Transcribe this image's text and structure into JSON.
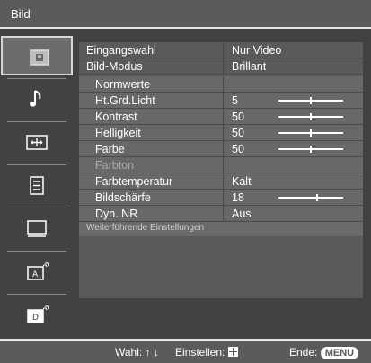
{
  "title": "Bild",
  "sidebar": {
    "items": [
      {
        "icon": "picture-icon",
        "selected": true
      },
      {
        "icon": "music-note-icon",
        "selected": false
      },
      {
        "icon": "screen-format-icon",
        "selected": false
      },
      {
        "icon": "settings-list-icon",
        "selected": false
      },
      {
        "icon": "monitor-icon",
        "selected": false
      },
      {
        "icon": "input-a-icon",
        "selected": false
      },
      {
        "icon": "input-d-icon",
        "selected": false
      }
    ]
  },
  "menu": {
    "rows": [
      {
        "label": "Eingangswahl",
        "value": "Nur Video"
      },
      {
        "label": "Bild-Modus",
        "value": "Brillant"
      },
      {
        "label": "Normwerte",
        "value": ""
      },
      {
        "label": "Ht.Grd.Licht",
        "value": "5",
        "level": 0.5
      },
      {
        "label": "Kontrast",
        "value": "50",
        "level": 0.5
      },
      {
        "label": "Helligkeit",
        "value": "50",
        "level": 0.5
      },
      {
        "label": "Farbe",
        "value": "50",
        "level": 0.5
      },
      {
        "label": "Farbton",
        "value": ""
      },
      {
        "label": "Farbtemperatur",
        "value": "Kalt"
      },
      {
        "label": "Bildschärfe",
        "value": "18",
        "level": 0.6
      },
      {
        "label": "Dyn. NR",
        "value": "Aus"
      }
    ],
    "more_label": "Weiterführende Einstellungen"
  },
  "footer": {
    "select_label": "Wahl:",
    "select_arrows": "↑ ↓",
    "set_label": "Einstellen:",
    "end_label": "Ende:",
    "menu_button": "MENU"
  }
}
